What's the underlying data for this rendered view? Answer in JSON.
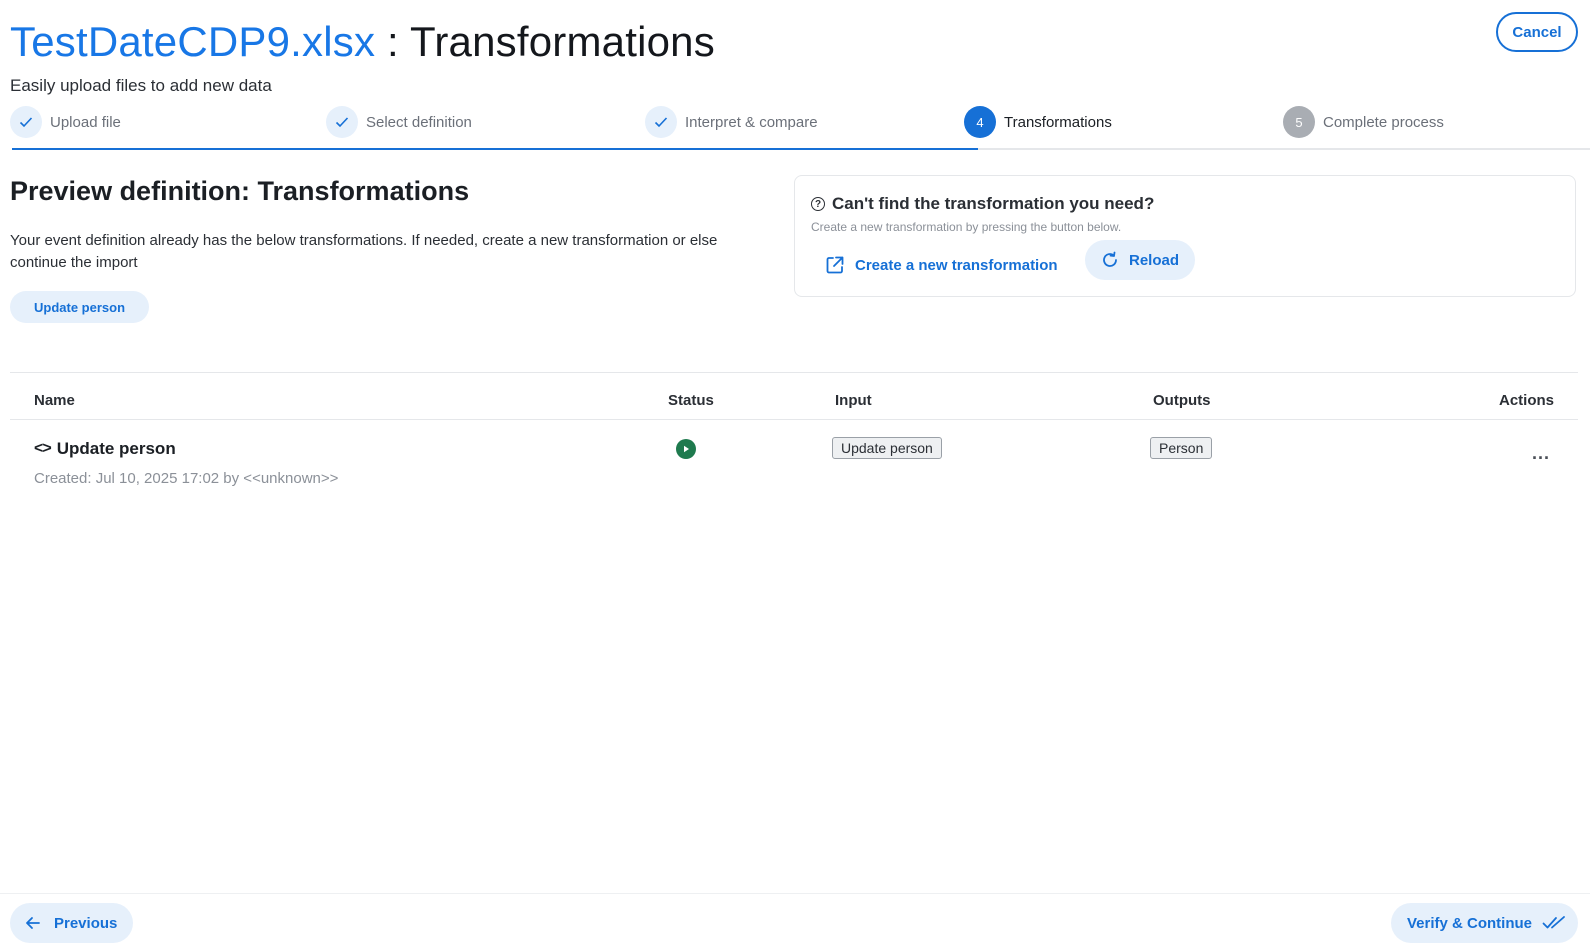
{
  "header": {
    "file_name": "TestDateCDP9.xlsx",
    "separator": " : ",
    "step_title": "Transformations",
    "subtitle": "Easily upload files to add new data",
    "cancel_label": "Cancel"
  },
  "stepper": {
    "steps": [
      {
        "label": "Upload file",
        "state": "done",
        "marker": "check-icon"
      },
      {
        "label": "Select definition",
        "state": "done",
        "marker": "check-icon"
      },
      {
        "label": "Interpret & compare",
        "state": "done",
        "marker": "check-icon"
      },
      {
        "label": "Transformations",
        "state": "active",
        "number": "4"
      },
      {
        "label": "Complete process",
        "state": "pending",
        "number": "5"
      }
    ]
  },
  "preview": {
    "title": "Preview definition: Transformations",
    "description": "Your event definition already has the below transformations. If needed, create a new transformation or else continue the import",
    "chip_label": "Update person"
  },
  "help_card": {
    "icon": "question-icon",
    "title": "Can't find the transformation you need?",
    "subtitle": "Create a new transformation by pressing the button below.",
    "create_label": "Create a new transformation",
    "reload_label": "Reload"
  },
  "table": {
    "columns": [
      "Name",
      "Status",
      "Input",
      "Outputs",
      "Actions"
    ],
    "rows": [
      {
        "name": "Update person",
        "created": "Created: Jul 10, 2025 17:02 by <<unknown>>",
        "status_icon": "play-icon",
        "status_color": "#1e7a4e",
        "input": "Update person",
        "output": "Person",
        "actions": "..."
      }
    ]
  },
  "footer": {
    "previous_label": "Previous",
    "next_label": "Verify & Continue"
  },
  "colors": {
    "accent": "#1670d6",
    "accent_light": "#e6f0fb",
    "file_name": "#1877e6",
    "status_running": "#1e7a4e"
  }
}
